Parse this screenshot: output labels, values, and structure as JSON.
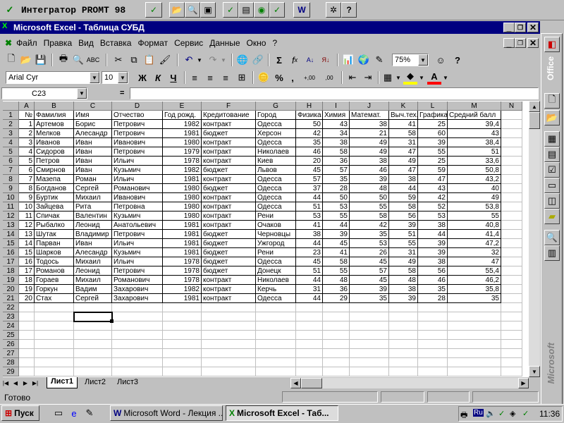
{
  "promt": {
    "title": "Интегратор PROMT 98"
  },
  "window": {
    "title": "Microsoft Excel - Таблица СУБД"
  },
  "menu": [
    "Файл",
    "Правка",
    "Вид",
    "Вставка",
    "Формат",
    "Сервис",
    "Данные",
    "Окно",
    "?"
  ],
  "format": {
    "font": "Arial Cyr",
    "size": "10",
    "bold": "Ж",
    "italic": "К",
    "underline": "Ч",
    "percent": "%",
    "comma": ",",
    "inc_dec": "+,00",
    "dec_dec": ",00",
    "font_color_letter": "A"
  },
  "zoom": "75%",
  "namebox": "C23",
  "formula_eq": "=",
  "col_letters": [
    "A",
    "B",
    "C",
    "D",
    "E",
    "F",
    "G",
    "H",
    "I",
    "J",
    "K",
    "L",
    "M",
    "N"
  ],
  "row_numbers": [
    "1",
    "2",
    "3",
    "4",
    "5",
    "6",
    "7",
    "8",
    "9",
    "10",
    "11",
    "12",
    "13",
    "14",
    "15",
    "16",
    "17",
    "18",
    "19",
    "20",
    "21",
    "22",
    "23",
    "24",
    "25",
    "26",
    "27",
    "28",
    "29"
  ],
  "headers": [
    "№",
    "Фамилия",
    "Имя",
    "Отчество",
    "Год рожд.",
    "Кредитование",
    "Город",
    "Физика",
    "Химия",
    "Математ.",
    "Выч.тех.",
    "Графика",
    "Средний балл"
  ],
  "rows": [
    [
      "1",
      "Артемов",
      "Борис",
      "Петрович",
      "1982",
      "контракт",
      "Одесса",
      "50",
      "43",
      "38",
      "41",
      "25",
      "39,4"
    ],
    [
      "2",
      "Мелков",
      "Алесандр",
      "Петрович",
      "1981",
      "бюджет",
      "Херсон",
      "42",
      "34",
      "21",
      "58",
      "60",
      "43"
    ],
    [
      "3",
      "Иванов",
      "Иван",
      "Иванович",
      "1980",
      "контракт",
      "Одесса",
      "35",
      "38",
      "49",
      "31",
      "39",
      "38,4"
    ],
    [
      "4",
      "Сидоров",
      "Иван",
      "Петрович",
      "1979",
      "контракт",
      "Николаев",
      "46",
      "58",
      "49",
      "47",
      "55",
      "51"
    ],
    [
      "5",
      "Петров",
      "Иван",
      "Ильич",
      "1978",
      "контракт",
      "Киев",
      "20",
      "36",
      "38",
      "49",
      "25",
      "33,6"
    ],
    [
      "6",
      "Смирнов",
      "Иван",
      "Кузьмич",
      "1982",
      "бюджет",
      "Львов",
      "45",
      "57",
      "46",
      "47",
      "59",
      "50,8"
    ],
    [
      "7",
      "Мазепа",
      "Роман",
      "Ильич",
      "1981",
      "контракт",
      "Одесса",
      "57",
      "35",
      "39",
      "38",
      "47",
      "43,2"
    ],
    [
      "8",
      "Богданов",
      "Сергей",
      "Романович",
      "1980",
      "бюджет",
      "Одесса",
      "37",
      "28",
      "48",
      "44",
      "43",
      "40"
    ],
    [
      "9",
      "Буртик",
      "Михаил",
      "Иванович",
      "1980",
      "контракт",
      "Одесса",
      "44",
      "50",
      "50",
      "59",
      "42",
      "49"
    ],
    [
      "10",
      "Зайцева",
      "Рита",
      "Петровна",
      "1980",
      "контракт",
      "Одесса",
      "51",
      "53",
      "55",
      "58",
      "52",
      "53,8"
    ],
    [
      "11",
      "Спичак",
      "Валентин",
      "Кузьмич",
      "1980",
      "контракт",
      "Рени",
      "53",
      "55",
      "58",
      "56",
      "53",
      "55"
    ],
    [
      "12",
      "Рыбалко",
      "Леонид",
      "Анатольевич",
      "1981",
      "контракт",
      "Очаков",
      "41",
      "44",
      "42",
      "39",
      "38",
      "40,8"
    ],
    [
      "13",
      "Шутак",
      "Владимир",
      "Петрович",
      "1981",
      "бюджет",
      "Черновцы",
      "38",
      "39",
      "35",
      "51",
      "44",
      "41,4"
    ],
    [
      "14",
      "Парван",
      "Иван",
      "Ильич",
      "1981",
      "бюджет",
      "Ужгород",
      "44",
      "45",
      "53",
      "55",
      "39",
      "47,2"
    ],
    [
      "15",
      "Шарков",
      "Алесандр",
      "Кузьмич",
      "1981",
      "бюджет",
      "Рени",
      "23",
      "41",
      "26",
      "31",
      "39",
      "32"
    ],
    [
      "16",
      "Тодось",
      "Михаил",
      "Ильич",
      "1978",
      "бюджет",
      "Одесса",
      "45",
      "58",
      "45",
      "49",
      "38",
      "47"
    ],
    [
      "17",
      "Романов",
      "Леонид",
      "Петрович",
      "1978",
      "бюджет",
      "Донецк",
      "51",
      "55",
      "57",
      "58",
      "56",
      "55,4"
    ],
    [
      "18",
      "Гораев",
      "Михаил",
      "Романович",
      "1978",
      "контракт",
      "Николаев",
      "44",
      "48",
      "45",
      "48",
      "46",
      "46,2"
    ],
    [
      "19",
      "Горкун",
      "Вадим",
      "Захарович",
      "1982",
      "контракт",
      "Керчь",
      "31",
      "36",
      "39",
      "38",
      "35",
      "35,8"
    ],
    [
      "20",
      "Стах",
      "Сергей",
      "Захарович",
      "1981",
      "контракт",
      "Одесса",
      "44",
      "29",
      "35",
      "39",
      "28",
      "35"
    ]
  ],
  "sheets": [
    "Лист1",
    "Лист2",
    "Лист3"
  ],
  "status": "Готово",
  "office_panel": {
    "label": "Office",
    "brand": "Microsoft"
  },
  "taskbar": {
    "start": "Пуск",
    "word": "Microsoft Word - Лекция ...",
    "excel": "Microsoft Excel - Таб...",
    "lang": "Ru",
    "time": "11:36"
  }
}
